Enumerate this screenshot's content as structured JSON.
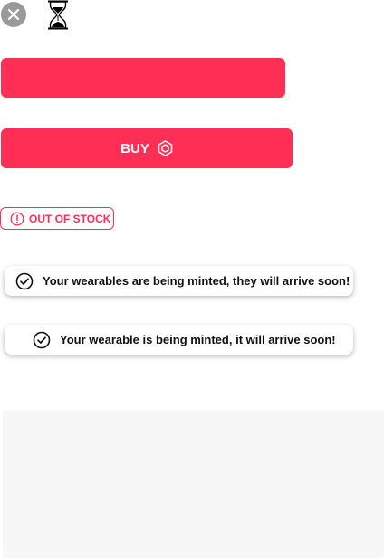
{
  "icons": {
    "close": "close-icon",
    "loading": "hourglass-icon",
    "buy": "hexagon-token-icon",
    "warning": "exclamation-circle-icon",
    "success": "check-circle-icon"
  },
  "colors": {
    "accent": "#ff2e55",
    "close_bg": "#9a9a9a",
    "panel_bg": "#f7f7f7",
    "text": "#111111"
  },
  "buy_button": {
    "label": "BUY"
  },
  "stock_badge": {
    "label": "OUT OF STOCK"
  },
  "toasts": [
    {
      "message": "Your wearables are being minted, they will arrive soon!"
    },
    {
      "message": "Your wearable is being minted, it will arrive soon!"
    }
  ]
}
